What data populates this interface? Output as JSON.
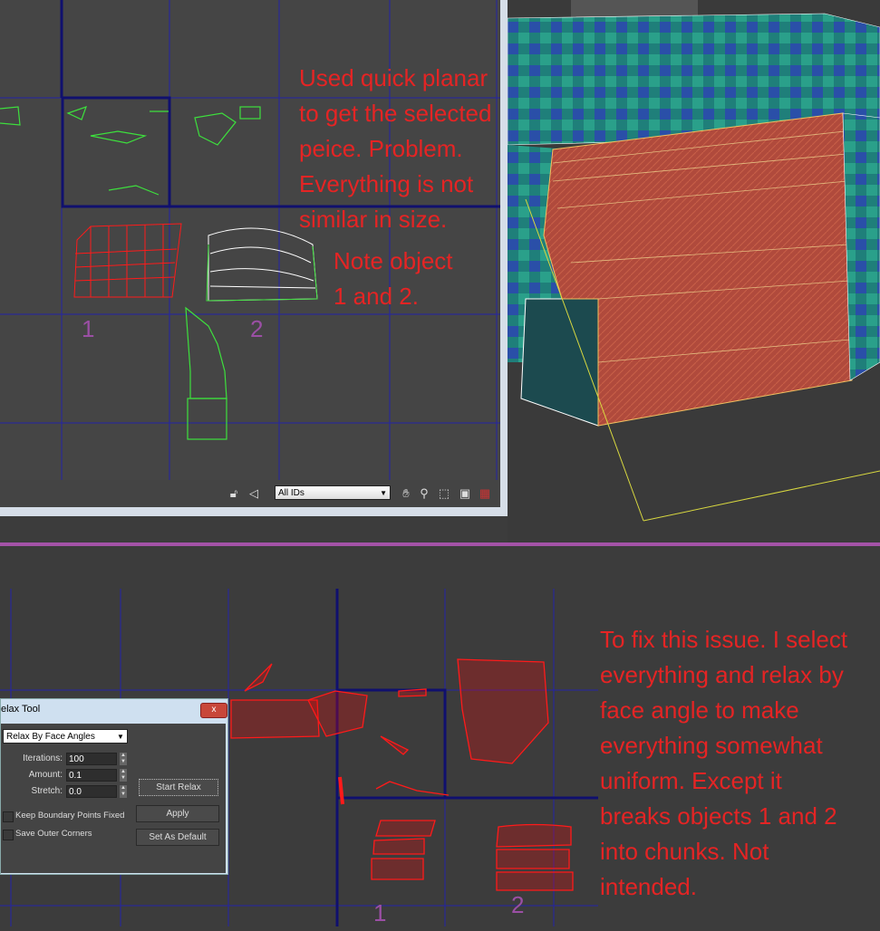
{
  "top_editor": {
    "filter_select": {
      "value": "All IDs"
    },
    "toolbar_icons": [
      "lock-icon",
      "paint-select-icon",
      "pan-hand-icon",
      "zoom-icon",
      "zoom-region-icon",
      "zoom-extents-icon",
      "grid-snap-icon"
    ],
    "annotation": "Used quick planar\nto get the selected\npeice. Problem.\nEverything is not\nsimilar in size.",
    "note": "Note object\n1 and 2.",
    "label_1": "1",
    "label_2": "2"
  },
  "bottom_editor": {
    "annotation": "To fix this issue. I select\neverything and relax by\nface angle to make\neverything somewhat\nuniform. Except it\nbreaks objects 1 and 2\ninto chunks. Not\nintended.",
    "label_1": "1",
    "label_2": "2"
  },
  "relax_dialog": {
    "title": "elax Tool",
    "close": "x",
    "mode": "Relax By Face Angles",
    "iterations_label": "Iterations:",
    "iterations": "100",
    "amount_label": "Amount:",
    "amount": "0.1",
    "stretch_label": "Stretch:",
    "stretch": "0.0",
    "keep_boundary": {
      "label": "Keep Boundary Points Fixed",
      "checked": false
    },
    "save_corners": {
      "label": "Save Outer Corners",
      "checked": false
    },
    "start_relax": "Start Relax",
    "apply": "Apply",
    "set_default": "Set As Default"
  },
  "colors": {
    "annotation": "#e52424",
    "label": "#9b4fa5",
    "divider": "#a453a8",
    "grid": "#1c1c9c",
    "uv_selected": "#ff0000",
    "uv_unselected": "#22dd22"
  }
}
